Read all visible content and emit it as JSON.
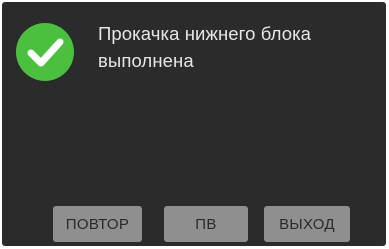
{
  "dialog": {
    "message": "Прокачка нижнего блока выполнена",
    "status_icon": "check-circle-icon",
    "accent_color": "#4bbf3e",
    "background_color": "#2b2b2b"
  },
  "buttons": {
    "repeat_label": "ПОВТОР",
    "pv_label": "ПВ",
    "exit_label": "ВЫХОД"
  }
}
